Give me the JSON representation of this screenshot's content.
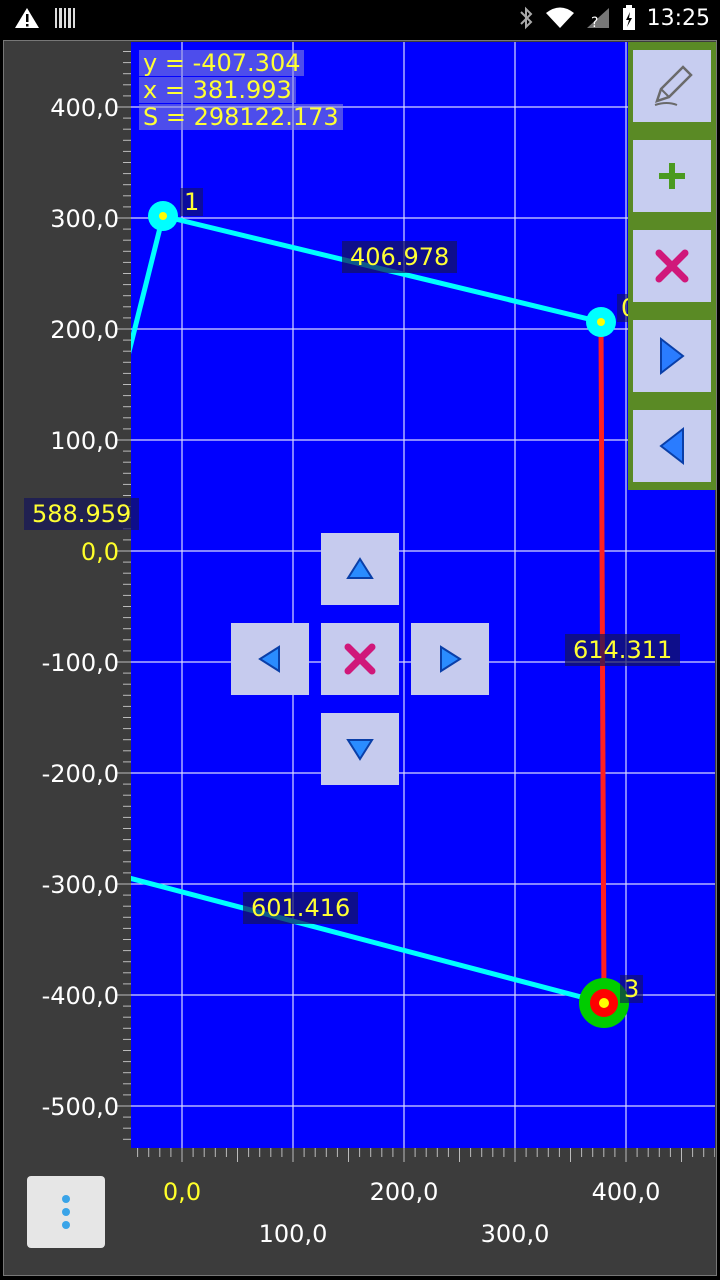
{
  "status_bar": {
    "time": "13:25"
  },
  "readout": {
    "y": "y = -407.304",
    "x": "x = 381.993",
    "s": "S = 298122.173"
  },
  "y_axis_labels": [
    "400,0",
    "300,0",
    "200,0",
    "100,0",
    "0,0",
    "-100,0",
    "-200,0",
    "-300,0",
    "-400,0",
    "-500,0"
  ],
  "x_axis_labels": [
    "0,0",
    "100,0",
    "200,0",
    "300,0",
    "400,0"
  ],
  "segment_labels": [
    "406.978",
    "614.311",
    "601.416",
    "588.959"
  ],
  "point_labels": [
    "0",
    "1",
    "3"
  ],
  "toolbar": [
    {
      "icon": "pencil-icon"
    },
    {
      "icon": "plus-icon"
    },
    {
      "icon": "close-icon"
    },
    {
      "icon": "arrow-right-icon"
    },
    {
      "icon": "arrow-left-icon"
    }
  ],
  "colors": {
    "plot_bg": "#0000ff",
    "polyline": "#00ffff",
    "active_segment": "#ff0000",
    "label_text": "#ffff33",
    "toolbar_bg": "#5a8a25",
    "grid": "#c0c0ff"
  }
}
